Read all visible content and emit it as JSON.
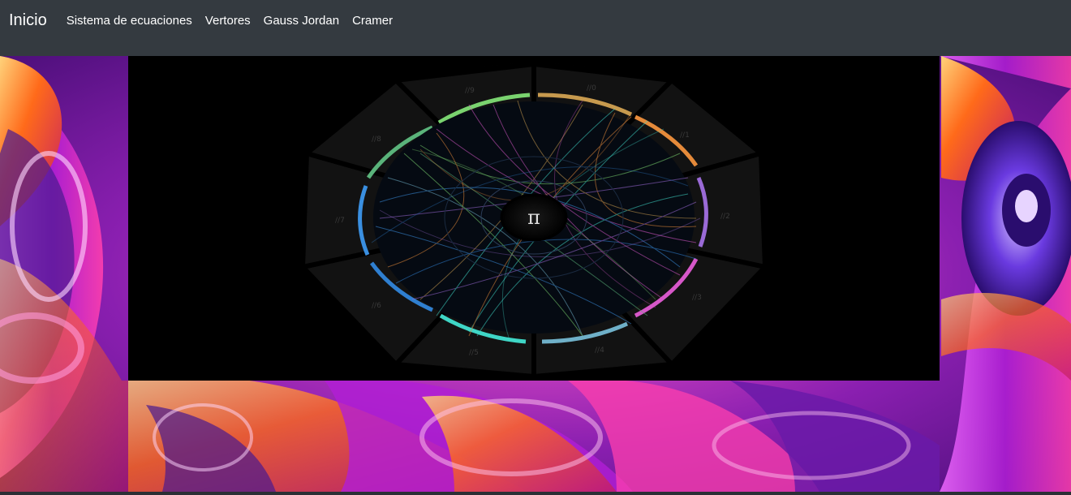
{
  "navbar": {
    "brand": "Inicio",
    "links": [
      {
        "label": "Sistema de ecuaciones"
      },
      {
        "label": "Vertores"
      },
      {
        "label": "Gauss Jordan"
      },
      {
        "label": "Cramer"
      }
    ],
    "background": "#343a40"
  },
  "hero": {
    "image_symbol": "π",
    "segment_labels": [
      "//0",
      "//1",
      "//2",
      "//3",
      "//4",
      "//5",
      "//6",
      "//7",
      "//8",
      "//9"
    ]
  },
  "colors": {
    "magenta": "#d12fd8",
    "orange": "#ff7a1a",
    "purple": "#5a1a9e",
    "cyan": "#27d4c6"
  }
}
